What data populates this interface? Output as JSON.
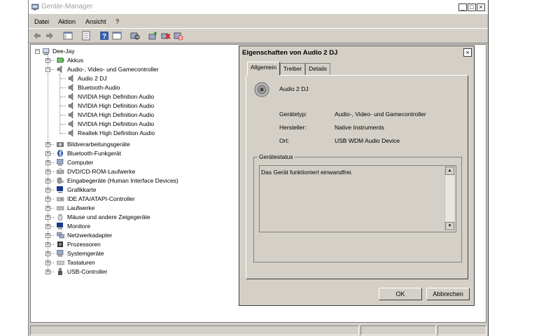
{
  "window": {
    "title": "Geräte-Manager",
    "min": "_",
    "max": "□",
    "close": "×"
  },
  "menu": [
    "Datei",
    "Aktion",
    "Ansicht",
    "?"
  ],
  "tree": {
    "root": "Dee-Jay",
    "items": [
      {
        "label": "Akkus",
        "icon": "battery-icon",
        "state": "collapsed"
      },
      {
        "label": "Audio-, Video- und Gamecontroller",
        "icon": "speaker-icon",
        "state": "expanded",
        "children": [
          "Audio 2 DJ",
          "Bluetooth-Audio",
          "NVIDIA High Definition Audio",
          "NVIDIA High Definition Audio",
          "NVIDIA High Definition Audio",
          "NVIDIA High Definition Audio",
          "Realtek High Definition Audio"
        ]
      },
      {
        "label": "Bildverarbeitungsgeräte",
        "icon": "camera-icon",
        "state": "collapsed"
      },
      {
        "label": "Bluetooth-Funkgerät",
        "icon": "bluetooth-icon",
        "state": "collapsed"
      },
      {
        "label": "Computer",
        "icon": "computer-icon",
        "state": "collapsed"
      },
      {
        "label": "DVD/CD-ROM-Laufwerke",
        "icon": "dvd-icon",
        "state": "collapsed"
      },
      {
        "label": "Eingabegeräte (Human Interface Devices)",
        "icon": "hid-icon",
        "state": "collapsed"
      },
      {
        "label": "Grafikkarte",
        "icon": "display-adapter-icon",
        "state": "collapsed"
      },
      {
        "label": "IDE ATA/ATAPI-Controller",
        "icon": "ide-icon",
        "state": "collapsed"
      },
      {
        "label": "Laufwerke",
        "icon": "drive-icon",
        "state": "collapsed"
      },
      {
        "label": "Mäuse und andere Zeigegeräte",
        "icon": "mouse-icon",
        "state": "collapsed"
      },
      {
        "label": "Monitore",
        "icon": "monitor-icon",
        "state": "collapsed"
      },
      {
        "label": "Netzwerkadapter",
        "icon": "network-icon",
        "state": "collapsed"
      },
      {
        "label": "Prozessoren",
        "icon": "cpu-icon",
        "state": "collapsed"
      },
      {
        "label": "Systemgeräte",
        "icon": "system-icon",
        "state": "collapsed"
      },
      {
        "label": "Tastaturen",
        "icon": "keyboard-icon",
        "state": "collapsed"
      },
      {
        "label": "USB-Controller",
        "icon": "usb-icon",
        "state": "collapsed"
      }
    ]
  },
  "dialog": {
    "title": "Eigenschaften von Audio 2 DJ",
    "close": "×",
    "tabs": [
      "Allgemein",
      "Treiber",
      "Details"
    ],
    "active_tab": "Allgemein",
    "device_name": "Audio 2 DJ",
    "props": [
      {
        "label": "Gerätetyp:",
        "value": "Audio-, Video- und Gamecontroller"
      },
      {
        "label": "Hersteller:",
        "value": "Native Instruments"
      },
      {
        "label": "Ort:",
        "value": "USB WDM Audio Device"
      }
    ],
    "status_group": "Gerätestatus",
    "status_text": "Das Gerät funktioniert einwandfrei.",
    "ok": "OK",
    "cancel": "Abbrechen"
  },
  "colors": {
    "face": "#d4d0c8",
    "title_gray": "#a0a0a0"
  }
}
